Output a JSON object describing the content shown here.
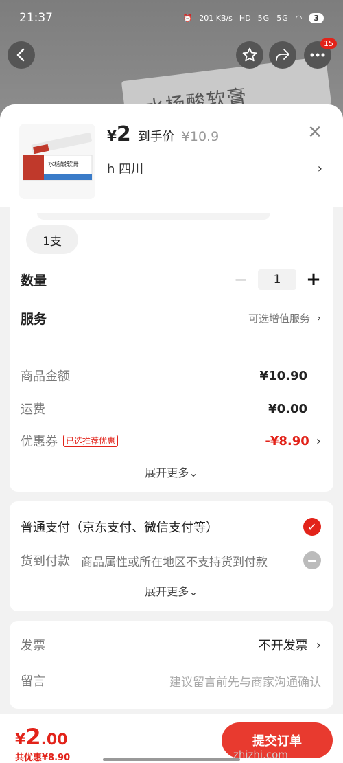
{
  "status_bar": {
    "time": "21:37",
    "net_speed": "201 KB/s",
    "hd": "HD",
    "sim1": "5G",
    "sim2": "5G",
    "battery": "3"
  },
  "background": {
    "product_label": "水杨酸软膏",
    "more_badge": "15"
  },
  "product": {
    "thumbnail_label": "水杨酸软膏",
    "price_symbol": "¥",
    "price": "2",
    "price_tag": "到手价",
    "original_price": "¥10.9",
    "address": "h  四川"
  },
  "spec": {
    "selected_option": "1支",
    "quantity_label": "数量",
    "quantity_value": "1",
    "service_label": "服务",
    "service_value": "可选增值服务"
  },
  "amount": {
    "goods_label": "商品金额",
    "goods_value": "¥10.90",
    "shipping_label": "运费",
    "shipping_value": "¥0.00",
    "coupon_label": "优惠券",
    "coupon_tag": "已选推荐优惠",
    "coupon_value": "-¥8.90",
    "expand": "展开更多⌄"
  },
  "payment": {
    "normal_pay": "普通支付（京东支付、微信支付等）",
    "cod_label": "货到付款",
    "cod_desc": "商品属性或所在地区不支持货到付款",
    "expand": "展开更多⌄"
  },
  "invoice": {
    "invoice_label": "发票",
    "invoice_value": "不开发票",
    "message_label": "留言",
    "message_placeholder": "建议留言前先与商家沟通确认"
  },
  "bottom": {
    "yen": "¥",
    "total_int": "2",
    "total_dec": ".00",
    "saved": "共优惠¥8.90",
    "submit": "提交订单"
  },
  "watermark": "zhizhi.com",
  "colors": {
    "accent": "#e2231a",
    "submit": "#e83a2f"
  }
}
